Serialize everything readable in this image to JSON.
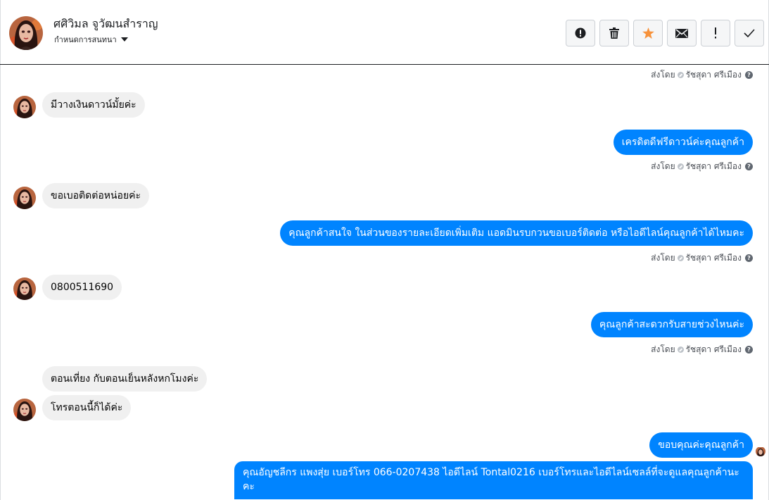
{
  "contact": {
    "name": "ศศิวิมล จูวัฒนสำราญ",
    "subtitle": "กำหนดการสนทนา"
  },
  "toolbar": {
    "actions": [
      "alert-circle-icon",
      "trash-icon",
      "star-icon",
      "envelope-icon",
      "exclamation-icon",
      "check-icon"
    ],
    "star_color": "#f7923b"
  },
  "sent_by": {
    "prefix": "ส่งโดย",
    "agent": "รัชสุดา ศรีเมือง"
  },
  "messages": [
    {
      "dir": "in",
      "text": "มีวางเงินดาวน์มั้ยค่ะ"
    },
    {
      "dir": "out",
      "text": "เครดิตดีฟรีดาวน์ค่ะคุณลูกค้า"
    },
    {
      "dir": "in",
      "text": "ขอเบอติดต่อหน่อยค่ะ"
    },
    {
      "dir": "out",
      "text": "คุณลูกค้าสนใจ ในส่วนของรายละเอียดเพิ่มเติม แอดมินรบกวนขอเบอร์ติดต่อ หรือไอดีไลน์คุณลูกค้าได้ไหมคะ"
    },
    {
      "dir": "in",
      "text": "0800511690"
    },
    {
      "dir": "out",
      "text": "คุณลูกค้าสะดวกรับสายช่วงไหนค่ะ"
    },
    {
      "dir": "in",
      "text": "ตอนเที่ยง กับตอนเย็นหลังหกโมงค่ะ"
    },
    {
      "dir": "in",
      "text": "โทรตอนนี้ก็ได้ค่ะ"
    },
    {
      "dir": "out",
      "text": "ขอบคุณค่ะคุณลูกค้า"
    },
    {
      "dir": "out",
      "text": "คุณอัญชลีกร แพงสุ่ย      เบอร์โทร 066-0207438 ไอดีไลน์ Tontal0216   เบอร์โทรและไอดีไลน์เซลล์ที่จะดูแลคุณลูกค้านะคะ"
    }
  ],
  "colors": {
    "outgoing_bubble": "#0084ff",
    "incoming_bubble": "#f0f0f0"
  }
}
